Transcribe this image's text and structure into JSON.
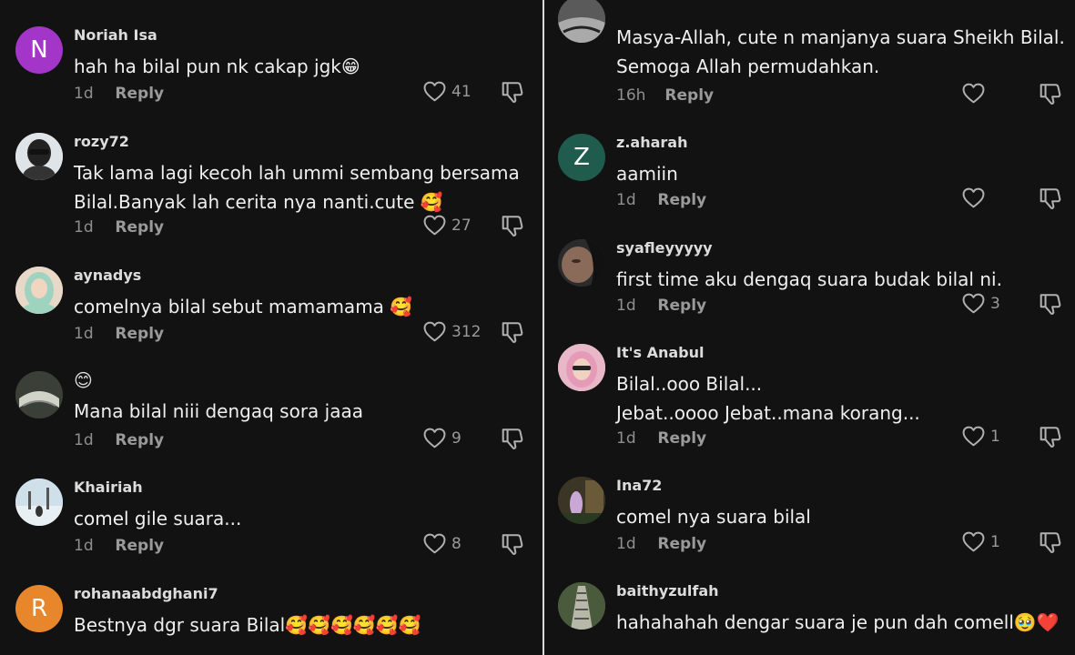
{
  "left_comments": [
    {
      "username": "Noriah Isa",
      "avatar_letter": "N",
      "avatar_color": "#a335c9",
      "text": "hah ha bilal pun nk cakap jgk😁",
      "time": "1d",
      "reply": "Reply",
      "likes": "41"
    },
    {
      "username": "rozy72",
      "avatar_color": "#dfe4e9",
      "text": "Tak lama lagi kecoh lah ummi sembang bersama\nBilal.Banyak lah cerita nya nanti.cute 🥰",
      "time": "1d",
      "reply": "Reply",
      "likes": "27"
    },
    {
      "username": "aynadys",
      "avatar_color": "#e8d8c8",
      "text": "comelnya bilal sebut mamamama 🥰",
      "time": "1d",
      "reply": "Reply",
      "likes": "312"
    },
    {
      "username": "😊",
      "avatar_color": "#3a3f38",
      "text": "Mana bilal niii dengaq sora jaaa",
      "time": "1d",
      "reply": "Reply",
      "likes": "9"
    },
    {
      "username": "Khairiah",
      "avatar_color": "#cfe0ea",
      "text": "comel gile suara...",
      "time": "1d",
      "reply": "Reply",
      "likes": "8"
    },
    {
      "username": "rohanaabdghani7",
      "avatar_letter": "R",
      "avatar_color": "#e8862b",
      "text": "Bestnya dgr suara Bilal🥰🥰🥰🥰🥰🥰",
      "time": "",
      "reply": "",
      "likes": ""
    }
  ],
  "right_comments": [
    {
      "username": "",
      "avatar_color": "#5a5a5a",
      "text": "Masya-Allah, cute n manjanya suara Sheikh Bilal.\nSemoga Allah permudahkan.",
      "time": "16h",
      "reply": "Reply",
      "likes": ""
    },
    {
      "username": "z.aharah",
      "avatar_letter": "Z",
      "avatar_color": "#1f5c4e",
      "text": "aamiin",
      "time": "1d",
      "reply": "Reply",
      "likes": ""
    },
    {
      "username": "syafleyyyyy",
      "avatar_color": "#2b2b2b",
      "text": "first time aku dengaq suara budak bilal ni.",
      "time": "1d",
      "reply": "Reply",
      "likes": "3"
    },
    {
      "username": "It's Anabul",
      "avatar_color": "#e8b7c8",
      "text": "Bilal..ooo Bilal...\nJebat..oooo Jebat..mana korang...",
      "time": "1d",
      "reply": "Reply",
      "likes": "1"
    },
    {
      "username": "Ina72",
      "avatar_color": "#3b3526",
      "text": "comel nya suara bilal",
      "time": "1d",
      "reply": "Reply",
      "likes": "1"
    },
    {
      "username": "baithyzulfah",
      "avatar_color": "#4a5a3c",
      "text": "hahahahah dengar suara je pun dah comell🥹❤️",
      "time": "",
      "reply": "",
      "likes": ""
    }
  ]
}
